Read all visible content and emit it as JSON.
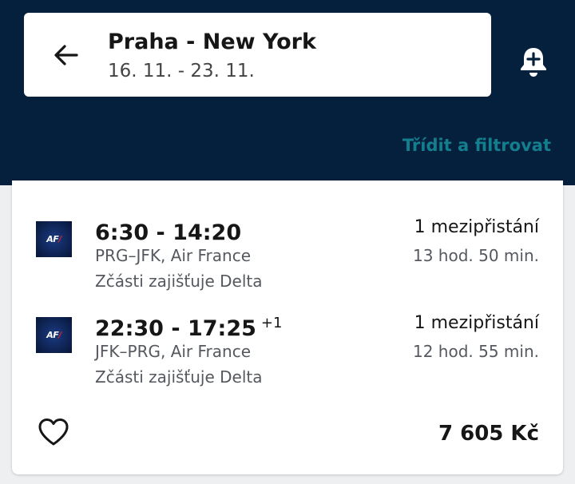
{
  "search": {
    "route": "Praha - New York",
    "dates": "16. 11. - 23. 11."
  },
  "icons": {
    "back": "arrow-left-icon",
    "alert": "bell-plus-icon",
    "favorite": "heart-icon"
  },
  "sort_filter_label": "Třídit a filtrovat",
  "colors": {
    "header_bg": "#05203c",
    "accent": "#127e8e"
  },
  "result": {
    "legs": [
      {
        "airline_logo_text": "AF",
        "times": "6:30 - 14:20",
        "day_offset": "",
        "route_airline": "PRG–JFK, Air France",
        "operated_by": "Zčásti zajišťuje Delta",
        "stops": "1 mezipřistání",
        "duration": "13 hod. 50 min."
      },
      {
        "airline_logo_text": "AF",
        "times": "22:30 - 17:25",
        "day_offset": "+1",
        "route_airline": "JFK–PRG, Air France",
        "operated_by": "Zčásti zajišťuje Delta",
        "stops": "1 mezipřistání",
        "duration": "12 hod. 55 min."
      }
    ],
    "price": "7 605 Kč"
  }
}
